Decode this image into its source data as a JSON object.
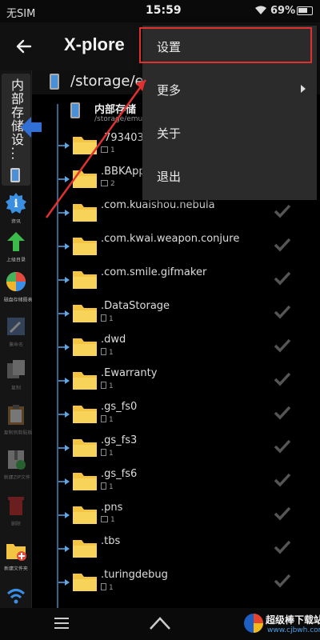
{
  "status_bar": {
    "carrier": "无SIM",
    "time": "15:59",
    "battery": "69%"
  },
  "app": {
    "title": "X-plore"
  },
  "path_bar": {
    "path": "/storage/em"
  },
  "side_tab": {
    "label": "内部存储设..."
  },
  "toolbar": [
    {
      "icon": "info-icon",
      "label": "资讯"
    },
    {
      "icon": "up-arrow-icon",
      "label": "上级目录"
    },
    {
      "icon": "disk-map-icon",
      "label": "磁盘存储图表"
    },
    {
      "icon": "edit-icon",
      "label": "重命名"
    },
    {
      "icon": "copy-icon",
      "label": "复制"
    },
    {
      "icon": "clipboard-icon",
      "label": "复制到剪贴板"
    },
    {
      "icon": "zip-icon",
      "label": "新建ZIP文件"
    },
    {
      "icon": "delete-icon",
      "label": "删除"
    },
    {
      "icon": "new-folder-icon",
      "label": "新建文件夹"
    }
  ],
  "root": {
    "name": "内部存储",
    "sub": "/storage/emu"
  },
  "files": [
    {
      "name": ".7934031",
      "meta_icon": "folder",
      "count": "1",
      "checked": false
    },
    {
      "name": ".BBKApp",
      "meta_icon": "folder",
      "count": "2",
      "checked": false
    },
    {
      "name": ".com.kuaishou.nebula",
      "meta_icon": "",
      "count": "",
      "checked": true
    },
    {
      "name": ".com.kwai.weapon.conjure",
      "meta_icon": "",
      "count": "",
      "checked": true
    },
    {
      "name": ".com.smile.gifmaker",
      "meta_icon": "",
      "count": "",
      "checked": true
    },
    {
      "name": ".DataStorage",
      "meta_icon": "file",
      "count": "1",
      "checked": true
    },
    {
      "name": ".dwd",
      "meta_icon": "file",
      "count": "1",
      "checked": true
    },
    {
      "name": ".Ewarranty",
      "meta_icon": "file",
      "count": "1",
      "checked": true
    },
    {
      "name": ".gs_fs0",
      "meta_icon": "file",
      "count": "1",
      "checked": true
    },
    {
      "name": ".gs_fs3",
      "meta_icon": "file",
      "count": "1",
      "checked": true
    },
    {
      "name": ".gs_fs6",
      "meta_icon": "file",
      "count": "1",
      "checked": true
    },
    {
      "name": ".pns",
      "meta_icon": "folder",
      "count": "1",
      "checked": true
    },
    {
      "name": ".tbs",
      "meta_icon": "",
      "count": "",
      "checked": true
    },
    {
      "name": ".turingdebug",
      "meta_icon": "file",
      "count": "1",
      "checked": true
    }
  ],
  "popup_menu": {
    "items": [
      {
        "label": "设置",
        "submenu": false
      },
      {
        "label": "更多",
        "submenu": true
      },
      {
        "label": "关于",
        "submenu": false
      },
      {
        "label": "退出",
        "submenu": false
      }
    ]
  },
  "watermark": {
    "name": "超级棒下载站",
    "url": "www.cjbwh.com"
  },
  "colors": {
    "accent": "#5fa7e6",
    "highlight": "#e03030",
    "folder": "#f4c542"
  }
}
